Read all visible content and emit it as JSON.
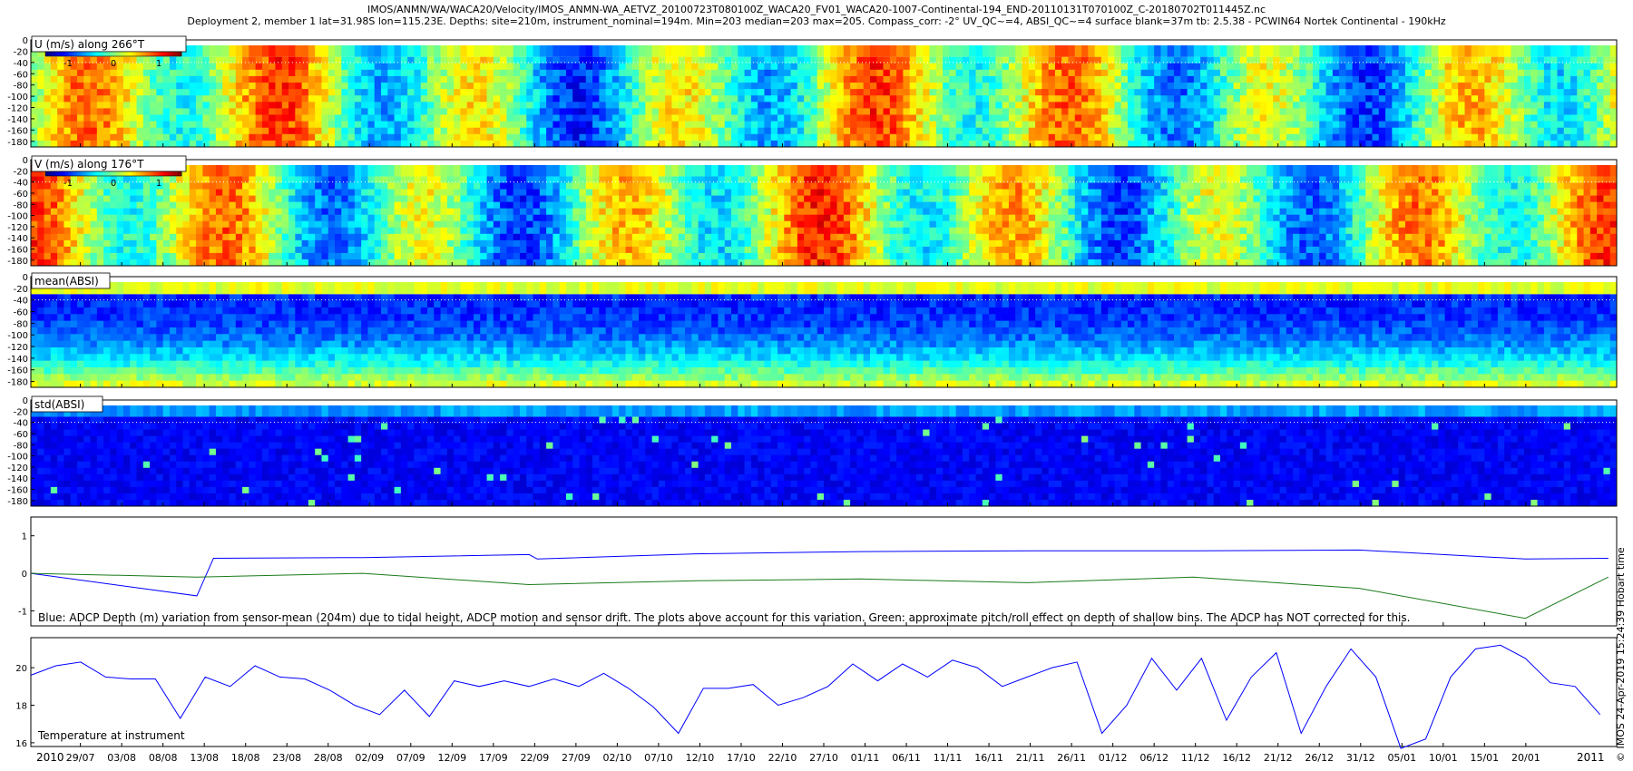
{
  "header": {
    "line1": "IMOS/ANMN/WA/WACA20/Velocity/IMOS_ANMN-WA_AETVZ_20100723T080100Z_WACA20_FV01_WACA20-1007-Continental-194_END-20110131T070100Z_C-20180702T011445Z.nc",
    "line2": "Deployment 2, member 1 lat=31.98S lon=115.23E. Depths: site=210m, instrument_nominal=194m. Min=203 median=203 max=205. Compass_corr: -2° UV_QC~=4, ABSI_QC~=4 surface blank=37m tb: 2.5.38 - PCWIN64 Nortek Continental - 190kHz"
  },
  "side_note": "© IMOS 24-Apr-2019 15:24:39 Hobart time",
  "colors": {
    "blue_series": "#0000ff",
    "green_series": "#1a7a1a",
    "dotted_line": "#ffffff"
  },
  "chart_data": [
    {
      "type": "heatmap",
      "title": "U (m/s) along 266°T",
      "colorbar": {
        "ticks": [
          -1,
          0,
          1
        ],
        "range": [
          -1.5,
          1.5
        ],
        "colormap": "jet"
      },
      "ylim": [
        -190,
        0
      ],
      "yticks": [
        0,
        -20,
        -40,
        -60,
        -80,
        -100,
        -120,
        -140,
        -160,
        -180
      ],
      "grid": false
    },
    {
      "type": "heatmap",
      "title": "V (m/s) along 176°T",
      "colorbar": {
        "ticks": [
          -1,
          0,
          1
        ],
        "range": [
          -1.5,
          1.5
        ],
        "colormap": "jet"
      },
      "ylim": [
        -190,
        0
      ],
      "yticks": [
        0,
        -20,
        -40,
        -60,
        -80,
        -100,
        -120,
        -140,
        -160,
        -180
      ],
      "grid": false
    },
    {
      "type": "heatmap",
      "title": "mean(ABSI)",
      "ylim": [
        -190,
        0
      ],
      "yticks": [
        0,
        -20,
        -40,
        -60,
        -80,
        -100,
        -120,
        -140,
        -160,
        -180
      ],
      "grid": false
    },
    {
      "type": "heatmap",
      "title": "std(ABSI)",
      "ylim": [
        -190,
        0
      ],
      "yticks": [
        0,
        -20,
        -40,
        -60,
        -80,
        -100,
        -120,
        -140,
        -160,
        -180
      ],
      "grid": false
    },
    {
      "type": "line",
      "annotation": "Blue: ADCP Depth (m) variation from sensor-mean (204m) due to tidal height, ADCP motion and sensor drift. The plots above account for this variation. Green: approximate pitch/roll effect on depth of shallow bins. The ADCP has NOT corrected for this.",
      "ylim": [
        -1.4,
        1.5
      ],
      "yticks": [
        1,
        0,
        -1
      ],
      "series": [
        {
          "color": "#0000ff",
          "x": [
            0,
            20,
            22,
            40,
            60,
            61,
            80,
            100,
            120,
            140,
            160,
            180,
            190
          ],
          "values": [
            0,
            -0.6,
            0.4,
            0.42,
            0.5,
            0.38,
            0.52,
            0.58,
            0.6,
            0.6,
            0.62,
            0.38,
            0.4
          ]
        },
        {
          "color": "#1a7a1a",
          "x": [
            0,
            20,
            40,
            60,
            80,
            100,
            120,
            140,
            160,
            180,
            190
          ],
          "values": [
            0,
            -0.1,
            0,
            -0.3,
            -0.2,
            -0.15,
            -0.25,
            -0.1,
            -0.4,
            -1.2,
            -0.1
          ]
        }
      ]
    },
    {
      "type": "line",
      "annotation": "Temperature at instrument",
      "ylim": [
        15.8,
        21.6
      ],
      "yticks": [
        20,
        18,
        16
      ],
      "series": [
        {
          "color": "#0000ff",
          "x": [
            0,
            3,
            6,
            9,
            12,
            15,
            18,
            21,
            24,
            27,
            30,
            33,
            36,
            39,
            42,
            45,
            48,
            51,
            54,
            57,
            60,
            63,
            66,
            69,
            72,
            75,
            78,
            81,
            84,
            87,
            90,
            93,
            96,
            99,
            102,
            105,
            108,
            111,
            114,
            117,
            120,
            123,
            126,
            129,
            132,
            135,
            138,
            141,
            144,
            147,
            150,
            153,
            156,
            159,
            162,
            165,
            168,
            171,
            174,
            177,
            180,
            183,
            186,
            189
          ],
          "values": [
            19.6,
            20.1,
            20.3,
            19.5,
            19.4,
            19.4,
            17.3,
            19.5,
            19.0,
            20.1,
            19.5,
            19.4,
            18.8,
            18.0,
            17.5,
            18.8,
            17.4,
            19.3,
            19.0,
            19.3,
            19.0,
            19.4,
            19.0,
            19.7,
            18.9,
            17.9,
            16.5,
            18.9,
            18.9,
            19.1,
            18.0,
            18.4,
            19.0,
            20.2,
            19.3,
            20.2,
            19.5,
            20.4,
            20.0,
            19.0,
            19.5,
            20.0,
            20.3,
            16.5,
            18.0,
            20.5,
            18.8,
            20.5,
            17.2,
            19.5,
            20.8,
            16.5,
            19.0,
            21.0,
            19.5,
            15.7,
            16.2,
            19.5,
            21.0,
            21.2,
            20.5,
            19.2,
            19.0,
            17.5
          ]
        }
      ]
    }
  ],
  "x_axis": {
    "start_date": "2010-07-23",
    "end_date": "2011-01-31",
    "tick_labels": [
      "29/07",
      "03/08",
      "08/08",
      "13/08",
      "18/08",
      "23/08",
      "28/08",
      "02/09",
      "07/09",
      "12/09",
      "17/09",
      "22/09",
      "27/09",
      "02/10",
      "07/10",
      "12/10",
      "17/10",
      "22/10",
      "27/10",
      "01/11",
      "06/11",
      "11/11",
      "16/11",
      "21/11",
      "26/11",
      "01/12",
      "06/12",
      "11/12",
      "16/12",
      "21/12",
      "26/12",
      "31/12",
      "05/01",
      "10/01",
      "15/01",
      "20/01"
    ],
    "year_start": "2010",
    "year_end": "2011"
  }
}
